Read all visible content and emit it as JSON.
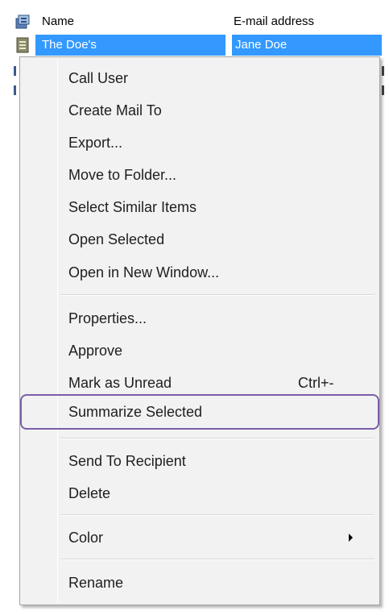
{
  "list": {
    "columns": {
      "name": "Name",
      "email": "E-mail address"
    },
    "selected_row": {
      "name": "The Doe's",
      "email": "Jane Doe"
    }
  },
  "context_menu": {
    "items": [
      {
        "label": "Call User"
      },
      {
        "label": "Create Mail To"
      },
      {
        "label": "Export..."
      },
      {
        "label": "Move to Folder..."
      },
      {
        "label": "Select Similar Items"
      },
      {
        "label": "Open Selected"
      },
      {
        "label": "Open in New Window..."
      },
      {
        "label": "Properties..."
      },
      {
        "label": "Approve"
      },
      {
        "label": "Mark as Unread",
        "shortcut": "Ctrl+-"
      },
      {
        "label": "Summarize Selected",
        "highlighted": true
      },
      {
        "label": "Send To Recipient"
      },
      {
        "label": "Delete"
      },
      {
        "label": "Color",
        "has_submenu": true
      },
      {
        "label": "Rename"
      }
    ]
  },
  "colors": {
    "selection": "#3399ff",
    "highlight_outline": "#7b5ea8",
    "menu_background": "#f2f2f2"
  },
  "icons": {
    "header": "contact-list-icon",
    "row": "contact-card-icon",
    "submenu": "submenu-arrow-icon"
  }
}
